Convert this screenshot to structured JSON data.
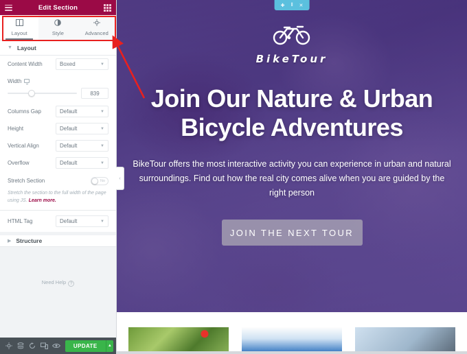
{
  "panel": {
    "header": {
      "title": "Edit Section",
      "menu_icon": "hamburger-icon",
      "grid_icon": "grid-apps-icon"
    },
    "tabs": [
      {
        "label": "Layout",
        "icon": "columns-icon",
        "active": true
      },
      {
        "label": "Style",
        "icon": "contrast-icon",
        "active": false
      },
      {
        "label": "Advanced",
        "icon": "gear-icon",
        "active": false
      }
    ],
    "sections": [
      {
        "title": "Layout",
        "expanded": true
      },
      {
        "title": "Structure",
        "expanded": false
      }
    ],
    "controls": {
      "content_width": {
        "label": "Content Width",
        "value": "Boxed"
      },
      "width": {
        "label": "Width",
        "value": "839",
        "device_icon": "desktop-icon"
      },
      "columns_gap": {
        "label": "Columns Gap",
        "value": "Default"
      },
      "height": {
        "label": "Height",
        "value": "Default"
      },
      "vertical_align": {
        "label": "Vertical Align",
        "value": "Default"
      },
      "overflow": {
        "label": "Overflow",
        "value": "Default"
      },
      "stretch_section": {
        "label": "Stretch Section",
        "state": "No"
      },
      "stretch_hint": "Stretch the section to the full width of the page using JS. ",
      "stretch_hint_link": "Learn more.",
      "html_tag": {
        "label": "HTML Tag",
        "value": "Default"
      }
    },
    "need_help": "Need Help",
    "footer": {
      "icons": [
        "gear-icon",
        "navigator-icon",
        "history-icon",
        "responsive-mode-icon",
        "preview-icon"
      ],
      "update_label": "UPDATE",
      "update_caret": "▲"
    },
    "collapse_handle": "‹"
  },
  "canvas": {
    "section_toolbar": {
      "add": "✚",
      "handle": "⦀",
      "close": "✕"
    },
    "hero": {
      "logo_icon": "bicycle-icon",
      "brand": "BikeTour",
      "headline_line1": "Join Our Nature & Urban",
      "headline_line2": "Bicycle Adventures",
      "subtext": "BikeTour offers the most interactive activity you can experience in urban and natural surroundings. Find out how the real city comes alive when you are guided by the right person",
      "cta_label": "JOIN THE NEXT TOUR"
    },
    "cards": [
      {
        "name": "card-trees-sign"
      },
      {
        "name": "card-sky-horizon"
      },
      {
        "name": "card-cyclist"
      }
    ]
  },
  "colors": {
    "panel_header": "#9b0a46",
    "update_green": "#39b54a",
    "section_toolbar": "#5bc0de",
    "annotation_red": "#e8201f"
  }
}
